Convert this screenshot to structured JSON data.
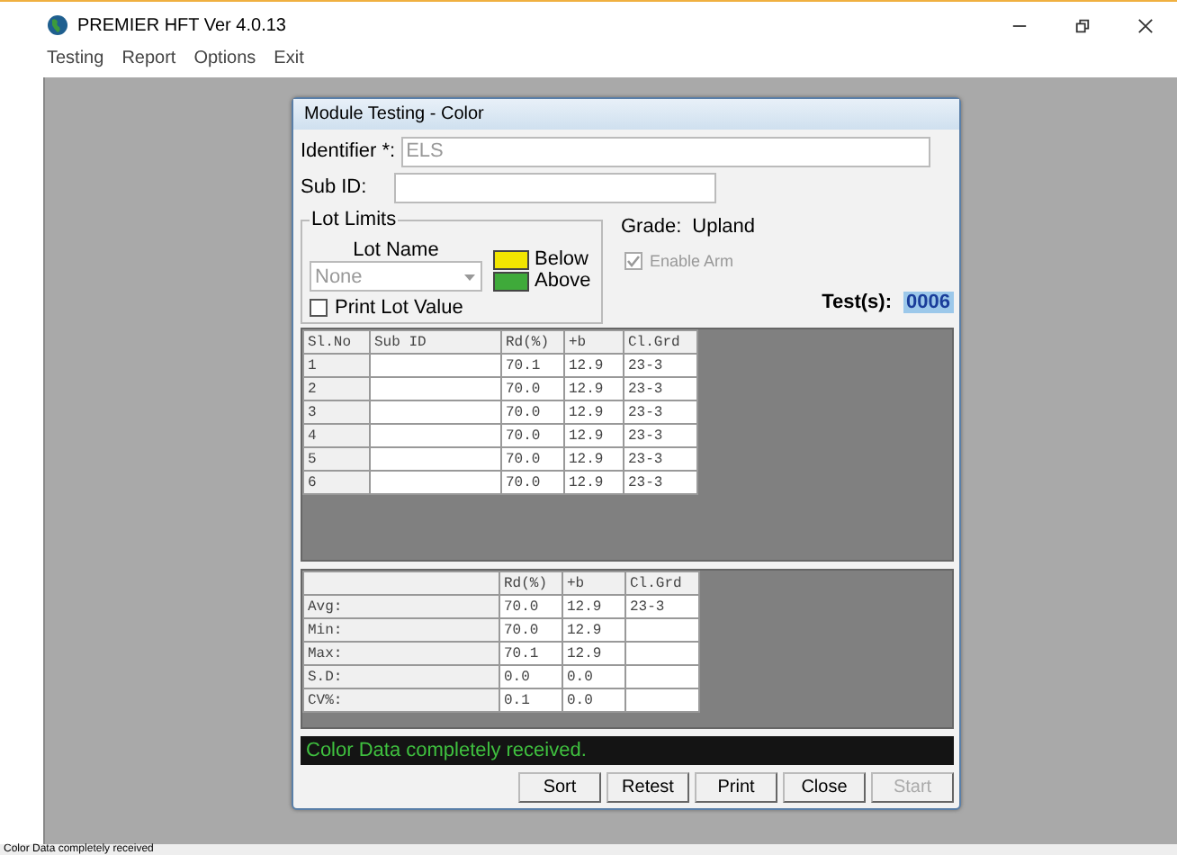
{
  "window": {
    "title": "PREMIER HFT  Ver 4.0.13"
  },
  "menu": [
    "Testing",
    "Report",
    "Options",
    "Exit"
  ],
  "dialog": {
    "title": "Module Testing - Color",
    "identifier": {
      "label": "Identifier *:",
      "value": "ELS"
    },
    "sub_id": {
      "label": "Sub ID:"
    },
    "lot_limits": {
      "title": "Lot Limits",
      "lot_name_label": "Lot Name",
      "lot_name_value": "None",
      "legend": [
        {
          "label": "Below",
          "color": "#f2e600"
        },
        {
          "label": "Above",
          "color": "#3faa3a"
        }
      ],
      "print_lot_value": {
        "label": "Print Lot Value",
        "checked": false
      }
    },
    "grade": {
      "label": "Grade:",
      "value": "Upland"
    },
    "enable_arm": {
      "label": "Enable Arm",
      "checked": true,
      "disabled": true
    },
    "tests": {
      "label": "Test(s):",
      "value": "0006"
    },
    "results": {
      "columns": [
        "Sl.No",
        "Sub ID",
        "Rd(%)",
        "+b",
        "Cl.Grd"
      ],
      "rows": [
        [
          "1",
          "",
          "70.1",
          "12.9",
          "23-3"
        ],
        [
          "2",
          "",
          "70.0",
          "12.9",
          "23-3"
        ],
        [
          "3",
          "",
          "70.0",
          "12.9",
          "23-3"
        ],
        [
          "4",
          "",
          "70.0",
          "12.9",
          "23-3"
        ],
        [
          "5",
          "",
          "70.0",
          "12.9",
          "23-3"
        ],
        [
          "6",
          "",
          "70.0",
          "12.9",
          "23-3"
        ]
      ]
    },
    "stats": {
      "columns": [
        "",
        "Rd(%)",
        "+b",
        "Cl.Grd"
      ],
      "rows": [
        [
          "Avg:",
          "70.0",
          "12.9",
          "23-3"
        ],
        [
          "Min:",
          "70.0",
          "12.9",
          ""
        ],
        [
          "Max:",
          "70.1",
          "12.9",
          ""
        ],
        [
          "S.D:",
          "0.0",
          "0.0",
          ""
        ],
        [
          "CV%:",
          "0.1",
          "0.0",
          ""
        ]
      ]
    },
    "message": "Color Data completely received.",
    "buttons": [
      {
        "label": "Sort",
        "disabled": false
      },
      {
        "label": "Retest",
        "disabled": false
      },
      {
        "label": "Print",
        "disabled": false
      },
      {
        "label": "Close",
        "disabled": false
      },
      {
        "label": "Start",
        "disabled": true
      }
    ]
  },
  "status_bar": "Color Data completely received"
}
